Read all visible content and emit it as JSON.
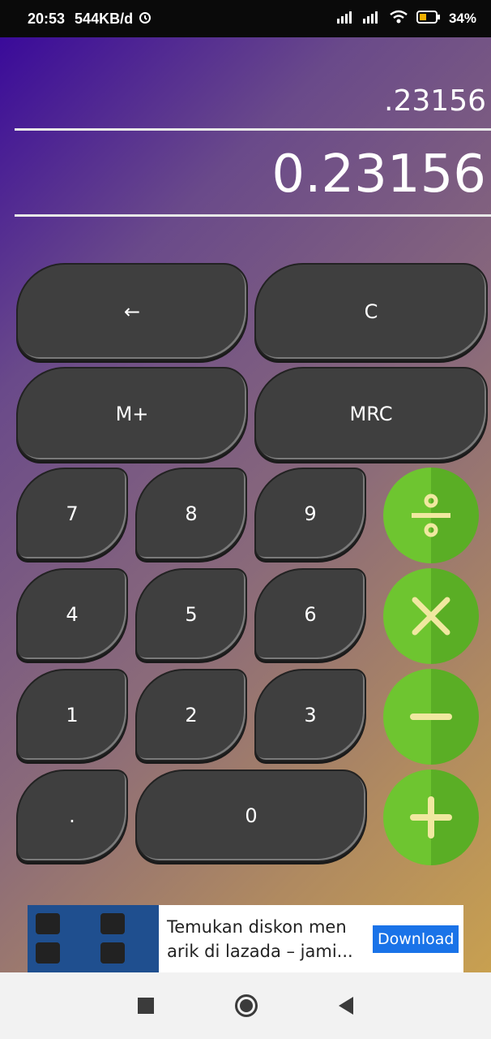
{
  "status": {
    "time": "20:53",
    "net_speed": "544KB/d",
    "battery": "34%"
  },
  "display": {
    "expression": ".23156",
    "result": "0.23156"
  },
  "keys": {
    "backspace": "←",
    "clear": "C",
    "mem_plus": "M+",
    "mrc": "MRC",
    "k7": "7",
    "k8": "8",
    "k9": "9",
    "k4": "4",
    "k5": "5",
    "k6": "6",
    "k1": "1",
    "k2": "2",
    "k3": "3",
    "dot": ".",
    "k0": "0"
  },
  "ad": {
    "text": "Temukan diskon men arik di lazada – jami...",
    "button": "Download"
  },
  "colors": {
    "key_bg": "#3f3f3f",
    "operator_green": "#6ec530",
    "operator_symbol": "#f0e8a0"
  }
}
